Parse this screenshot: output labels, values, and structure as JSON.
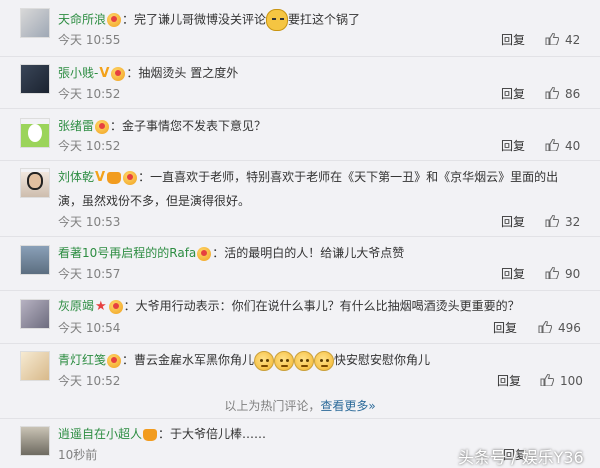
{
  "comments": [
    {
      "username": "天命所浪",
      "badges": [
        "vip"
      ],
      "text_parts": [
        "：完了谦儿哥微博没关评论",
        "要扛这个锅了"
      ],
      "time": "今天 10:55",
      "reply_label": "回复",
      "likes": "42"
    },
    {
      "username": "張小贱-",
      "badges": [
        "v-badge",
        "vip"
      ],
      "text_parts": [
        "：抽烟烫头 置之度外"
      ],
      "time": "今天 10:52",
      "reply_label": "回复",
      "likes": "86"
    },
    {
      "username": "张绪雷",
      "badges": [
        "vip"
      ],
      "text_parts": [
        "：金子事情您不发表下意见？"
      ],
      "time": "今天 10:52",
      "reply_label": "回复",
      "likes": "40"
    },
    {
      "username": "刘体乾",
      "badges": [
        "v-badge",
        "crown",
        "vip"
      ],
      "text_parts": [
        "：一直喜欢于老师，特别喜欢于老师在《天下第一丑》和《京华烟云》里面的出",
        "演，虽然戏份不多，但是演得很好。"
      ],
      "time": "今天 10:53",
      "reply_label": "回复",
      "likes": "32"
    },
    {
      "username": "看著10号再启程的的Rafa",
      "badges": [
        "vip"
      ],
      "text_parts": [
        "：活的最明白的人！给谦儿大爷点赞"
      ],
      "time": "今天 10:57",
      "reply_label": "回复",
      "likes": "90"
    },
    {
      "username": "灰原竭",
      "badges": [
        "star",
        "vip"
      ],
      "text_parts": [
        "：大爷用行动表示：你们在说什么事儿？有什么比抽烟喝酒烫头更重要的？"
      ],
      "time": "今天 10:54",
      "reply_label": "回复",
      "likes": "496"
    },
    {
      "username": "青灯红笺",
      "badges": [
        "vip"
      ],
      "text_parts": [
        "：曹云金雇水军黑你角儿",
        "快安慰安慰你角儿"
      ],
      "time": "今天 10:52",
      "reply_label": "回复",
      "likes": "100"
    }
  ],
  "hot_footer": {
    "text": "以上为热门评论，",
    "more_link": "查看更多»"
  },
  "latest_comment": {
    "username": "逍遥自在小超人",
    "text": "：于大爷倍儿棒……",
    "time": "10秒前",
    "reply_label": "回复"
  },
  "watermark": "头条号 / 娱乐Y36",
  "colors": {
    "username": "#2d8d42",
    "link": "#2d6b9a",
    "time": "#808080",
    "background": "#f2f2f5"
  }
}
